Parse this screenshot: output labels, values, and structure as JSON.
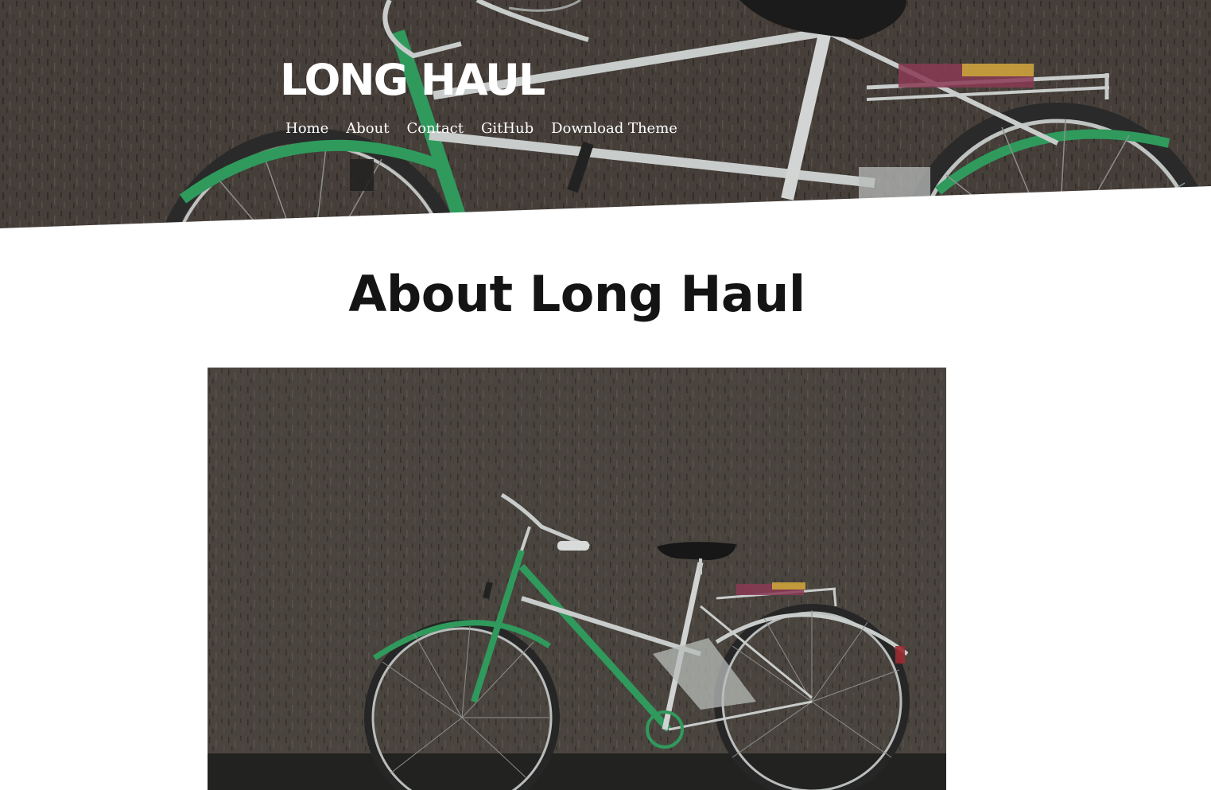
{
  "site": {
    "title": "LONG HAUL"
  },
  "nav": {
    "items": [
      {
        "label": "Home"
      },
      {
        "label": "About"
      },
      {
        "label": "Contact"
      },
      {
        "label": "GitHub"
      },
      {
        "label": "Download Theme"
      }
    ]
  },
  "main": {
    "page_title": "About Long Haul"
  },
  "colors": {
    "wall": "#5a514b",
    "bike_green": "#2f9a5c",
    "title_text": "#141414",
    "header_text": "#ffffff"
  }
}
